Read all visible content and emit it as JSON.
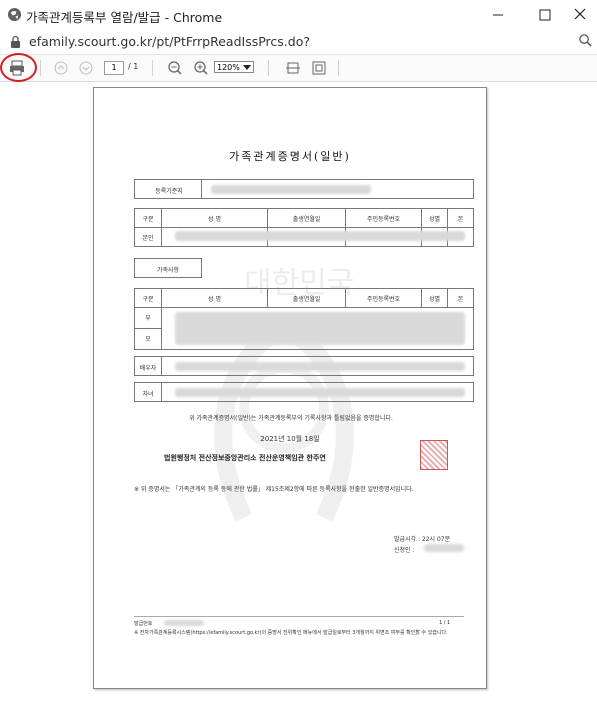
{
  "window": {
    "title": "가족관계등록부 열람/발급 - Chrome"
  },
  "browser": {
    "url": "efamily.scourt.go.kr/pt/PtFrrpReadIssPrcs.do?"
  },
  "toolbar": {
    "page_current": "1",
    "page_total": "/ 1",
    "zoom": "120%"
  },
  "document": {
    "title": "가족관계증명서(일반)",
    "registry_label": "등록기준지",
    "self_header": [
      "구분",
      "성 명",
      "출생연월일",
      "주민등록번호",
      "성별",
      "본"
    ],
    "self_row_label": "본인",
    "family_box_label": "가족사항",
    "family_header": [
      "구분",
      "성 명",
      "출생연월일",
      "주민등록번호",
      "성별",
      "본"
    ],
    "family_rows": [
      "부",
      "모",
      "배우자",
      "자녀"
    ],
    "certify_text": "위 가족관계증명서(일반)는 가족관계등록부의 기록사항과 틀림없음을 증명합니다.",
    "date": "2021년 10월 18일",
    "issuer": "법원행정처 전산정보중앙관리소 전산운영책임관 한주연",
    "note": "※ 위 증명서는 「가족관계의 등록 등에 관한 법률」 제15조제2항에 따른 등록사항을 현출한 일반증명서입니다.",
    "issue_time": "발급시각 : 22시 07분",
    "applicant": "신청인 :",
    "doc_no_label": "발급번호",
    "page_no": "1 / 1",
    "footer_note": "※ 전자가족관계등록시스템(https://efamily.scourt.go.kr)의 증명서 진위확인 메뉴에서 발급일로부터 3개월까지 위변조 여부를 확인할 수 있습니다.",
    "watermark": "대한민국"
  }
}
